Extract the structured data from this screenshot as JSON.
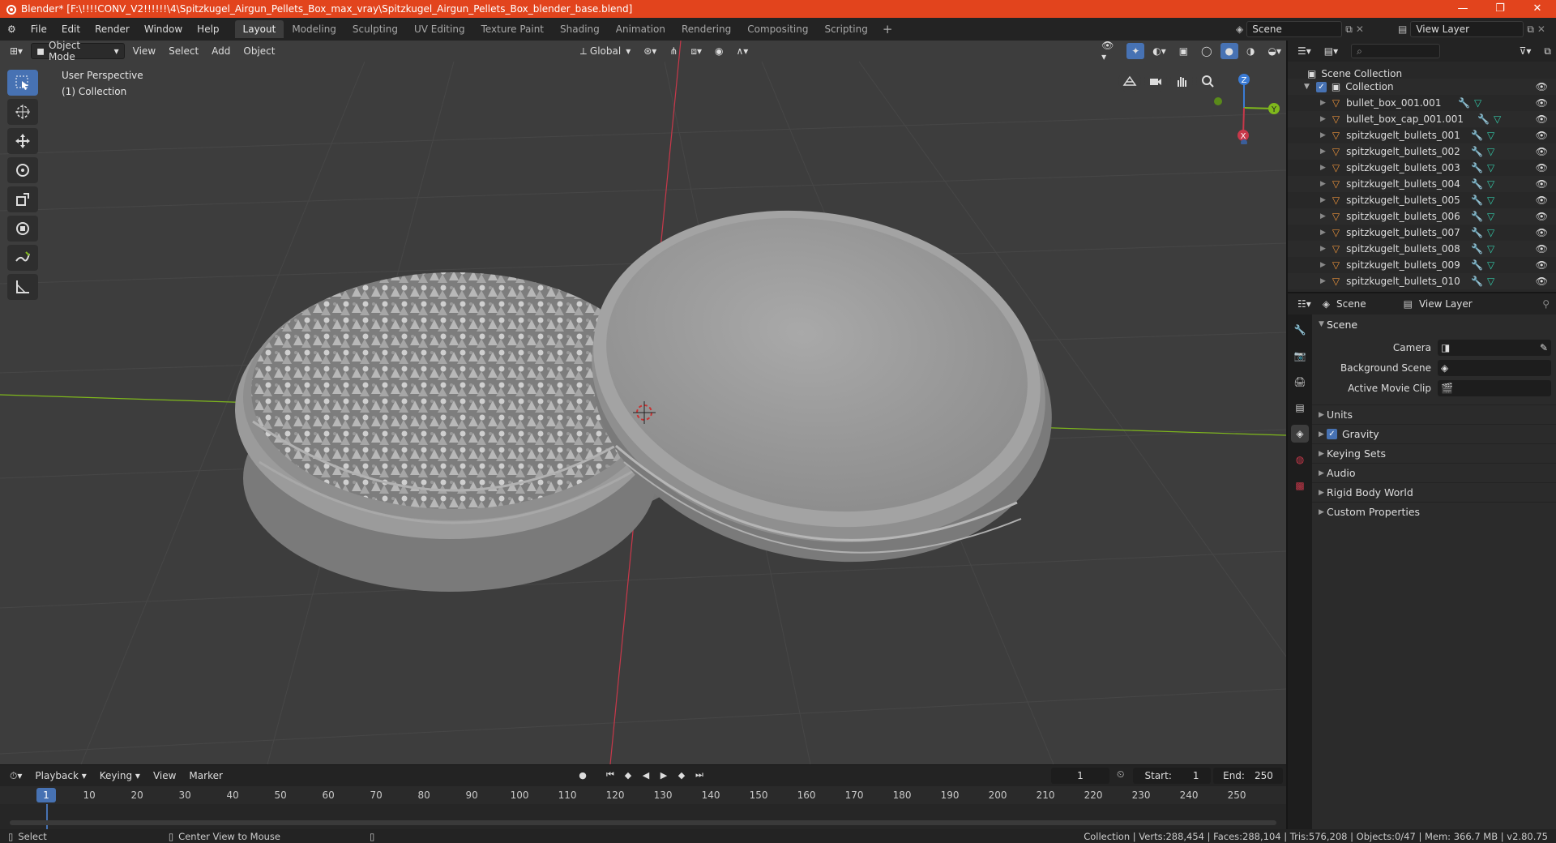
{
  "window": {
    "title": "Blender* [F:\\!!!!CONV_V2!!!!!!\\4\\Spitzkugel_Airgun_Pellets_Box_max_vray\\Spitzkugel_Airgun_Pellets_Box_blender_base.blend]"
  },
  "menu": [
    "File",
    "Edit",
    "Render",
    "Window",
    "Help"
  ],
  "workspaces": [
    "Layout",
    "Modeling",
    "Sculpting",
    "UV Editing",
    "Texture Paint",
    "Shading",
    "Animation",
    "Rendering",
    "Compositing",
    "Scripting"
  ],
  "active_workspace": "Layout",
  "scene_selector": {
    "value": "Scene"
  },
  "view_layer_selector": {
    "value": "View Layer"
  },
  "viewport": {
    "mode": "Object Mode",
    "menus": [
      "View",
      "Select",
      "Add",
      "Object"
    ],
    "orientation": "Global",
    "info_line1": "User Perspective",
    "info_line2": "(1) Collection",
    "gizmo": {
      "x": "X",
      "y": "Y",
      "z": "Z"
    }
  },
  "timeline": {
    "menus": [
      "Playback",
      "Keying",
      "View",
      "Marker"
    ],
    "current_frame": "1",
    "start_label": "Start:",
    "start": "1",
    "end_label": "End:",
    "end": "250",
    "ticks": [
      "1",
      "10",
      "20",
      "30",
      "40",
      "50",
      "60",
      "70",
      "80",
      "90",
      "100",
      "110",
      "120",
      "130",
      "140",
      "150",
      "160",
      "170",
      "180",
      "190",
      "200",
      "210",
      "220",
      "230",
      "240",
      "250"
    ]
  },
  "status": {
    "left1": "Select",
    "left2": "Center View to Mouse",
    "right": "Collection | Verts:288,454 | Faces:288,104 | Tris:576,208 | Objects:0/47 | Mem: 366.7 MB | v2.80.75"
  },
  "outliner": {
    "root": "Scene Collection",
    "collection": "Collection",
    "items": [
      "bullet_box_001.001",
      "bullet_box_cap_001.001",
      "spitzkugelt_bullets_001",
      "spitzkugelt_bullets_002",
      "spitzkugelt_bullets_003",
      "spitzkugelt_bullets_004",
      "spitzkugelt_bullets_005",
      "spitzkugelt_bullets_006",
      "spitzkugelt_bullets_007",
      "spitzkugelt_bullets_008",
      "spitzkugelt_bullets_009",
      "spitzkugelt_bullets_010"
    ]
  },
  "properties": {
    "header_scene": "Scene",
    "header_view_layer": "View Layer",
    "panel": "Scene",
    "camera_label": "Camera",
    "background_scene_label": "Background Scene",
    "active_movie_clip_label": "Active Movie Clip",
    "sub_units": "Units",
    "sub_gravity": "Gravity",
    "sub_keying_sets": "Keying Sets",
    "sub_audio": "Audio",
    "sub_rigid_body": "Rigid Body World",
    "sub_custom": "Custom Properties"
  },
  "colors": {
    "accent": "#4772b3",
    "title_bar": "#e2441d",
    "viewport_bg": "#3d3d3d",
    "axis_x": "#c8384a",
    "axis_y": "#7fb81c",
    "axis_z": "#3a7bd5"
  }
}
